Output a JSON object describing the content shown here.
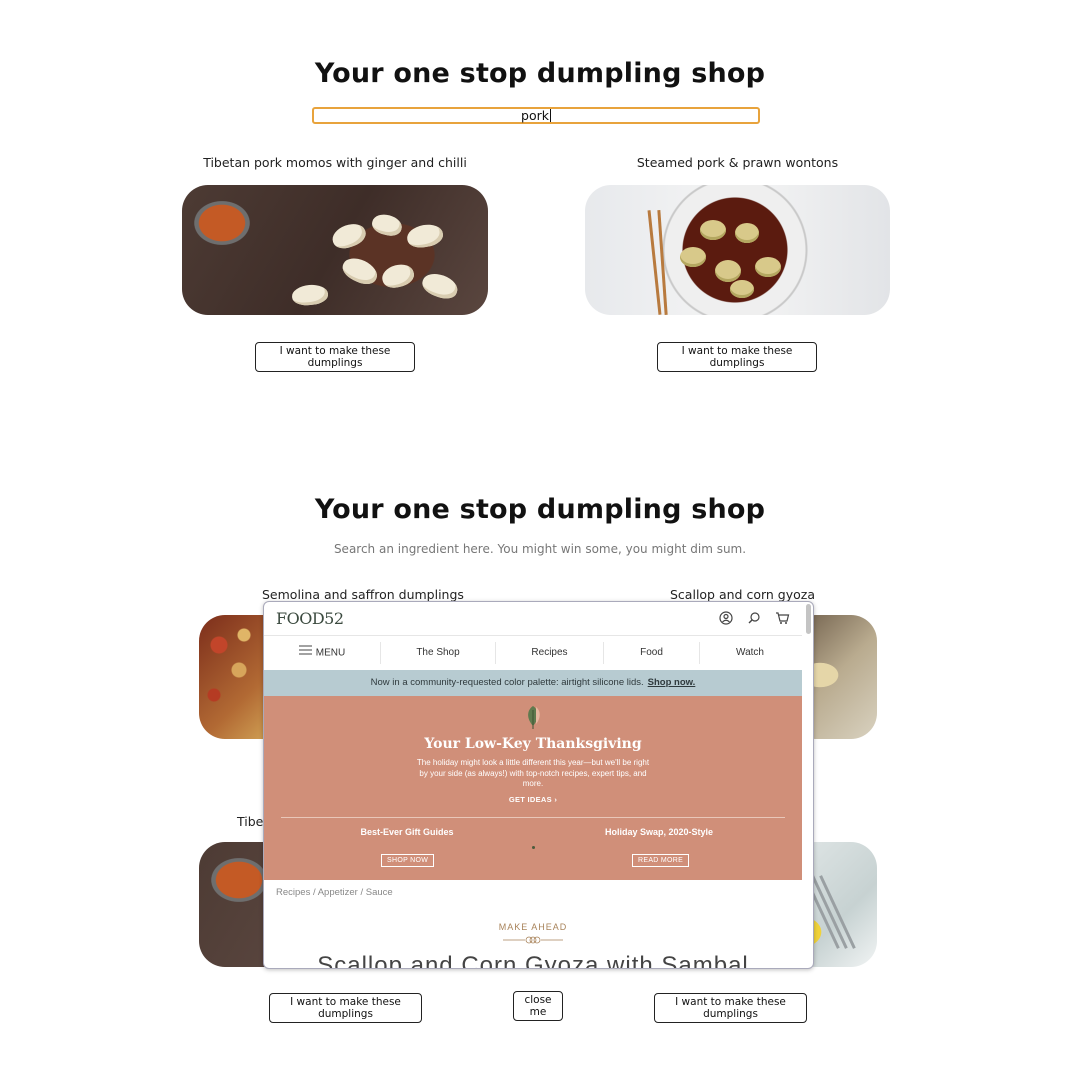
{
  "top": {
    "title": "Your one stop dumpling shop",
    "search_value": "pork",
    "results": [
      {
        "title": "Tibetan pork momos with ginger and chilli",
        "button": "I want to make these dumplings"
      },
      {
        "title": "Steamed pork & prawn wontons",
        "button": "I want to make these dumplings"
      }
    ]
  },
  "bottom": {
    "title": "Your one stop dumpling shop",
    "subtitle": "Search an ingredient here. You might win some, you might dim sum.",
    "results": [
      {
        "title": "Semolina and saffron dumplings"
      },
      {
        "title": "Scallop and corn gyoza"
      },
      {
        "title": "Tibet"
      }
    ],
    "buttons": {
      "make_left": "I want to make these dumplings",
      "close": "close me",
      "make_right": "I want to make these dumplings"
    }
  },
  "popup": {
    "logo": "FOOD52",
    "nav": {
      "menu": "MENU",
      "items": [
        "The Shop",
        "Recipes",
        "Food",
        "Watch"
      ]
    },
    "banner": {
      "text": "Now in a community-requested color palette: airtight silicone lids.",
      "link": "Shop now."
    },
    "hero": {
      "title": "Your Low-Key Thanksgiving",
      "body": "The holiday might look a little different this year—but we'll be right by your side (as always!) with top-notch recipes, expert tips, and more.",
      "cta": "GET IDEAS",
      "left": {
        "title": "Best-Ever Gift Guides",
        "cta": "SHOP NOW"
      },
      "right": {
        "title": "Holiday Swap, 2020-Style",
        "cta": "READ MORE"
      }
    },
    "breadcrumb": "Recipes / Appetizer / Sauce",
    "tag": "MAKE AHEAD",
    "recipe_title": "Scallop and Corn Gyoza with Sambal"
  },
  "colors": {
    "accent": "#e8a33c",
    "hero_bg": "#d08f79",
    "banner_bg": "#b7cbd1"
  },
  "icons": [
    "user-icon",
    "search-icon",
    "cart-icon",
    "hamburger-icon",
    "chevron-right-icon",
    "leaf-icon"
  ]
}
